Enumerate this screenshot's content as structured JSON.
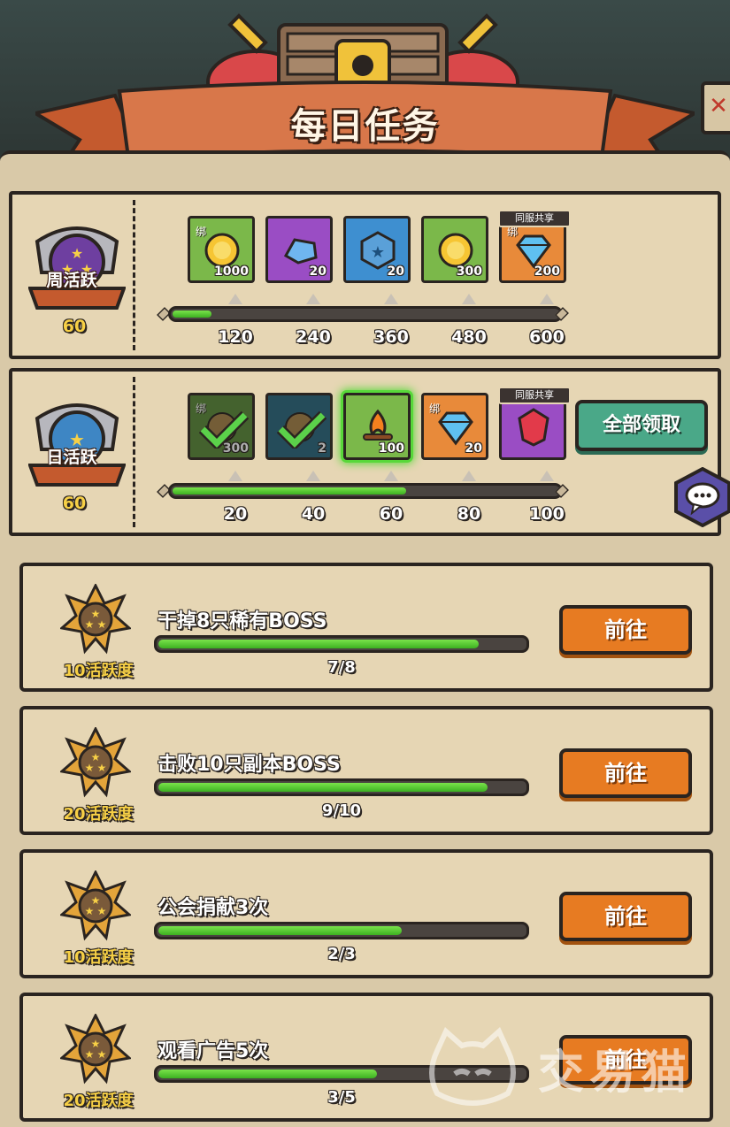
{
  "header": {
    "title": "每日任务"
  },
  "weekly": {
    "badge_label": "周活跃",
    "badge_value": "60",
    "progress": 0.1,
    "ticks": [
      "120",
      "240",
      "360",
      "480",
      "600"
    ],
    "rewards": [
      {
        "icon": "gold-coin-icon",
        "amount": "1000",
        "bind": "绑",
        "bg": "#7bb84a",
        "shared": false
      },
      {
        "icon": "blue-crystal-icon",
        "amount": "20",
        "bind": "",
        "bg": "#9a4dc4",
        "shared": false
      },
      {
        "icon": "blue-star-gem-icon",
        "amount": "20",
        "bind": "",
        "bg": "#3e8fd0",
        "shared": false
      },
      {
        "icon": "gold-coin-icon",
        "amount": "300",
        "bind": "",
        "bg": "#7bb84a",
        "shared": false
      },
      {
        "icon": "diamond-icon",
        "amount": "200",
        "bind": "绑",
        "bg": "#e88a3a",
        "shared": true,
        "share_label": "同服共享"
      }
    ]
  },
  "daily": {
    "badge_label": "日活跃",
    "badge_value": "60",
    "progress": 0.6,
    "ticks": [
      "20",
      "40",
      "60",
      "80",
      "100"
    ],
    "claim_all_label": "全部领取",
    "rewards": [
      {
        "icon": "check-icon",
        "amount": "300",
        "bind": "绑",
        "bg": "#5f8d3c",
        "done": true
      },
      {
        "icon": "check-icon",
        "amount": "2",
        "bind": "",
        "bg": "#2f6a80",
        "done": true
      },
      {
        "icon": "campfire-icon",
        "amount": "100",
        "bind": "",
        "bg": "#7bb84a",
        "highlight": true
      },
      {
        "icon": "diamond-icon",
        "amount": "20",
        "bind": "绑",
        "bg": "#e88a3a"
      },
      {
        "icon": "red-gem-icon",
        "amount": "",
        "bind": "",
        "bg": "#9a4dc4",
        "shared": true,
        "share_label": "同服共享"
      }
    ]
  },
  "tasks": [
    {
      "name": "干掉8只稀有BOSS",
      "points": "10活跃度",
      "count": "7/8",
      "progress": 0.875,
      "button": "前往"
    },
    {
      "name": "击败10只副本BOSS",
      "points": "20活跃度",
      "count": "9/10",
      "progress": 0.9,
      "button": "前往"
    },
    {
      "name": "公会捐献3次",
      "points": "10活跃度",
      "count": "2/3",
      "progress": 0.667,
      "button": "前往"
    },
    {
      "name": "观看广告5次",
      "points": "20活跃度",
      "count": "3/5",
      "progress": 0.6,
      "button": "前往"
    }
  ],
  "watermark": "交易猫",
  "colors": {
    "green_fill": "#4cc22a",
    "orange_button": "#e77b22",
    "teal_button": "#4aa888",
    "panel": "#e6d6b4"
  }
}
